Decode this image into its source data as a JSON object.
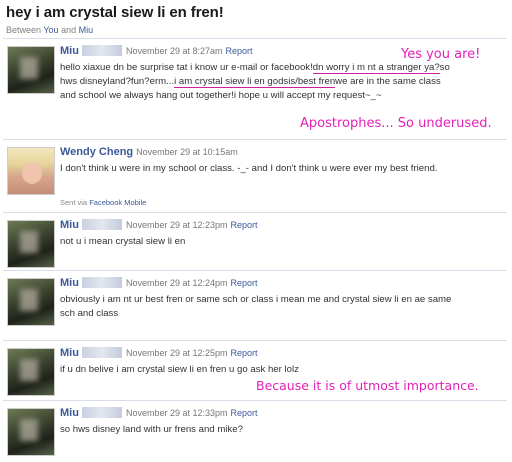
{
  "thread": {
    "title": "hey i am crystal siew li en fren!",
    "between_prefix": "Between ",
    "participant_you": "You",
    "and_word": " and ",
    "participant_other": "Miu"
  },
  "messages": [
    {
      "sender": "Miu",
      "name_obscured": true,
      "timestamp": "November 29 at 8:27am",
      "report": "Report",
      "text_a": "hello xiaxue dn be surprise tat i know ur e-mail or facebook!",
      "text_b": "dn worry i m nt a stranger ya?",
      "text_c": "so hws disneyland?fun?erm...",
      "text_d": "i am crystal siew li en godsis/best fren",
      "text_e": "we are in the same class and school we always hang out together!i hope u will accept my request~_~"
    },
    {
      "sender": "Wendy Cheng",
      "timestamp": "November 29 at 10:15am",
      "text": "I don't think u were in my school or class. -_- and I don't think u were ever my best friend.",
      "sent_via_prefix": "Sent via ",
      "sent_via_link": "Facebook Mobile"
    },
    {
      "sender": "Miu",
      "name_obscured": true,
      "timestamp": "November 29 at 12:23pm",
      "report": "Report",
      "text": "not u i mean crystal siew li en"
    },
    {
      "sender": "Miu",
      "name_obscured": true,
      "timestamp": "November 29 at 12:24pm",
      "report": "Report",
      "text": "obviously i am nt ur best fren or same sch or class i mean me and crystal siew li en ae same sch and class"
    },
    {
      "sender": "Miu",
      "name_obscured": true,
      "timestamp": "November 29 at 12:25pm",
      "report": "Report",
      "text": "if u dn belive i am crystal siew li en fren u go ask her lolz"
    },
    {
      "sender": "Miu",
      "name_obscured": true,
      "timestamp": "November 29 at 12:33pm",
      "report": "Report",
      "text": "so hws disney land with ur frens and mike?"
    }
  ],
  "annotations": {
    "note1": "Yes you are!",
    "note2": "Apostrophes... So underused.",
    "note3": "Because it is of utmost importance."
  },
  "colors": {
    "link": "#3b5998",
    "annotation": "#e520b8",
    "divider": "#d9dfea"
  }
}
